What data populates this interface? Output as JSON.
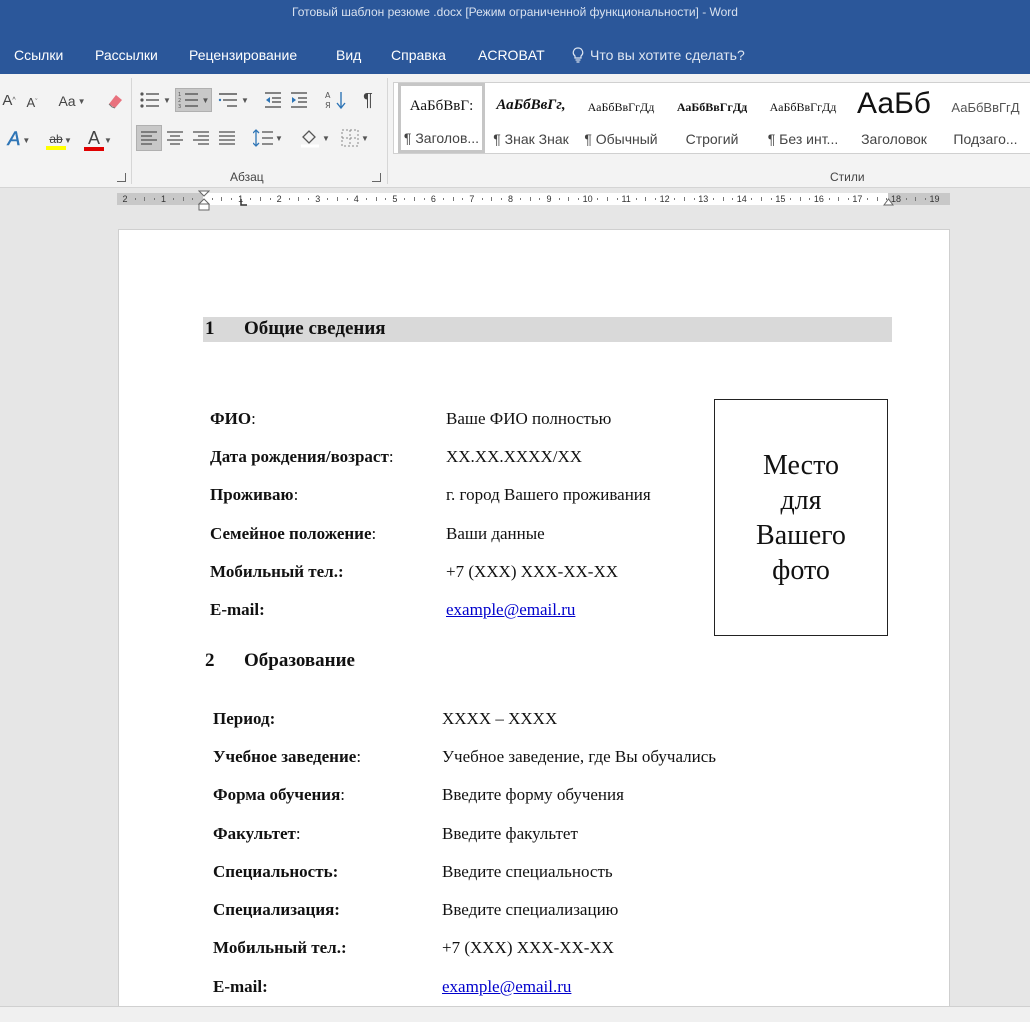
{
  "window": {
    "title": "Готовый шаблон резюме .docx [Режим ограниченной функциональности]  -  Word"
  },
  "tabs": {
    "links": "Ссылки",
    "mailings": "Рассылки",
    "review": "Рецензирование",
    "view": "Вид",
    "help": "Справка",
    "acrobat": "ACROBAT",
    "tell_me": "Что вы хотите сделать?"
  },
  "ribbon": {
    "paragraph_group": "Абзац",
    "styles_group": "Стили",
    "font_buttons": {
      "grow": "A",
      "shrink": "A",
      "case": "Aa",
      "effects": "A",
      "highlight": "ab",
      "color": "A"
    },
    "pilcrow": "¶",
    "colors": {
      "highlight": "#ffff00",
      "font_color": "#e00000",
      "effects": "#2e75b6"
    },
    "styles": [
      {
        "sample": "АаБбВвГ:",
        "name": "¶ Заголов..."
      },
      {
        "sample": "АаБбВвГг,",
        "name": "¶ Знак Знак"
      },
      {
        "sample": "АаБбВвГгДд",
        "name": "¶ Обычный"
      },
      {
        "sample": "АаБбВвГгДд",
        "name": "Строгий"
      },
      {
        "sample": "АаБбВвГгДд",
        "name": "¶ Без инт..."
      },
      {
        "sample": "АаБб",
        "name": "Заголовок"
      },
      {
        "sample": "АаБбВвГгД",
        "name": "Подзаго..."
      }
    ]
  },
  "ruler": {
    "labels": [
      "2",
      "1",
      "",
      "1",
      "2",
      "3",
      "4",
      "5",
      "6",
      "7",
      "8",
      "9",
      "10",
      "11",
      "12",
      "13",
      "14",
      "15",
      "16",
      "17",
      "18",
      "19"
    ]
  },
  "document": {
    "section1": {
      "number": "1",
      "title": "Общие сведения"
    },
    "general": [
      {
        "label": "ФИО",
        "suffix": ":",
        "value": "Ваше ФИО полностью"
      },
      {
        "label": "Дата рождения/возраст",
        "suffix": ":",
        "value": "XX.XX.XXXX/XX"
      },
      {
        "label": "Проживаю",
        "suffix": ":",
        "value": "г. город Вашего проживания"
      },
      {
        "label": "Семейное положение",
        "suffix": ":",
        "value": "Ваши данные"
      },
      {
        "label": "Мобильный тел.:",
        "suffix": "",
        "value": "+7 (XXX) XXX-XX-XX"
      },
      {
        "label": "E-mail:",
        "suffix": "",
        "value": "example@email.ru"
      }
    ],
    "photo": {
      "line1": "Место",
      "line2": "для",
      "line3": "Вашего",
      "line4": "фото"
    },
    "section2": {
      "number": "2",
      "title": "Образование"
    },
    "education": [
      {
        "label": "Период:",
        "suffix": "",
        "value": "XXXX – XXXX"
      },
      {
        "label": "Учебное заведение",
        "suffix": ":",
        "value": "Учебное заведение, где Вы обучались"
      },
      {
        "label": "Форма обучения",
        "suffix": ":",
        "value": "Введите форму обучения"
      },
      {
        "label": "Факультет",
        "suffix": ":",
        "value": "Введите факультет"
      },
      {
        "label": "Специальность:",
        "suffix": "",
        "value": "Введите специальность"
      },
      {
        "label": "Специализация:",
        "suffix": "",
        "value": "Введите специализацию"
      },
      {
        "label": "Мобильный тел.:",
        "suffix": "",
        "value": "+7 (XXX) XXX-XX-XX"
      },
      {
        "label": "E-mail:",
        "suffix": "",
        "value": "example@email.ru"
      }
    ]
  }
}
